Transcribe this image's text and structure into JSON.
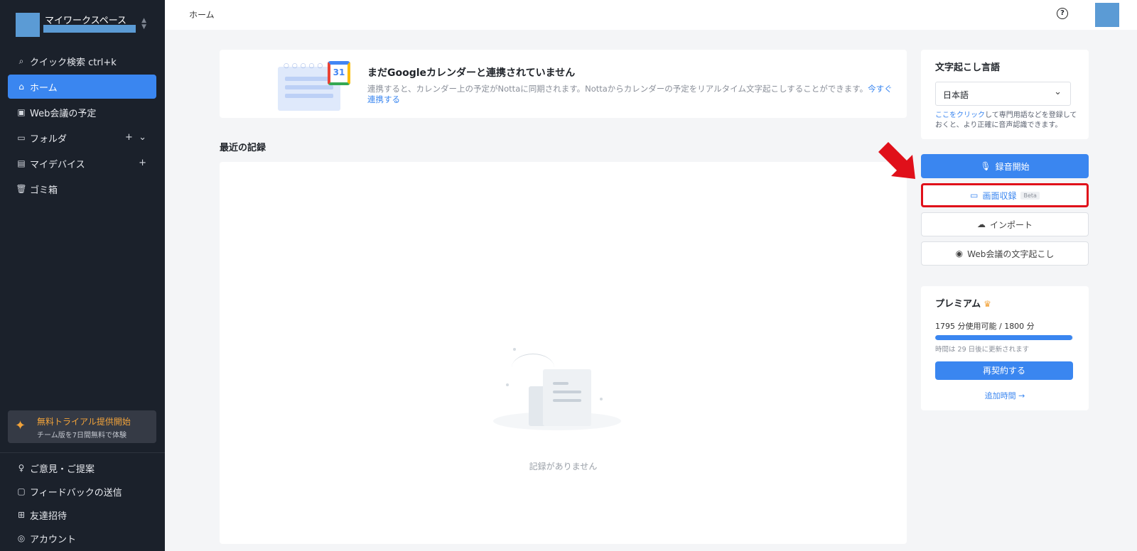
{
  "workspace": {
    "name": "マイワークスペース"
  },
  "sidebar": {
    "items": [
      {
        "label": "クイック検索 ctrl+k",
        "icon": "search-icon"
      },
      {
        "label": "ホーム",
        "icon": "home-icon",
        "active": true
      },
      {
        "label": "Web会議の予定",
        "icon": "calendar-icon"
      },
      {
        "label": "フォルダ",
        "icon": "folder-icon"
      },
      {
        "label": "マイデバイス",
        "icon": "device-icon"
      },
      {
        "label": "ゴミ箱",
        "icon": "trash-icon"
      }
    ],
    "trial": {
      "title": "無料トライアル提供開始",
      "subtitle": "チーム版を7日間無料で体験"
    },
    "bottom_items": [
      {
        "label": "ご意見・ご提案",
        "icon": "lightbulb-icon"
      },
      {
        "label": "フィードバックの送信",
        "icon": "feedback-icon"
      },
      {
        "label": "友達招待",
        "icon": "gift-icon"
      },
      {
        "label": "アカウント",
        "icon": "account-icon"
      }
    ]
  },
  "topbar": {
    "breadcrumb": "ホーム",
    "help_icon": "?"
  },
  "banner": {
    "title": "まだGoogleカレンダーと連携されていません",
    "description": "連携すると、カレンダー上の予定がNottaに同期されます。Nottaからカレンダーの予定をリアルタイム文字起こしすることができます。",
    "link": "今すぐ連携する",
    "calendar_day": "31"
  },
  "records": {
    "title": "最近の記録",
    "empty_text": "記録がありません"
  },
  "language": {
    "title": "文字起こし言語",
    "selected": "日本語",
    "hint_link": "ここをクリック",
    "hint_text": "して専門用語などを登録しておくと、より正確に音声認識できます。"
  },
  "actions": {
    "record": "録音開始",
    "screen": "画面収録",
    "beta": "Beta",
    "import": "インポート",
    "web": "Web会議の文字起こし"
  },
  "premium": {
    "title": "プレミアム",
    "usage": "1795 分使用可能 / 1800 分",
    "usage_fraction": 0.997,
    "renew_note": "時間は 29 日後に更新されます",
    "renew_button": "再契約する",
    "more": "追加時間 →"
  },
  "colors": {
    "accent": "#3a86f0",
    "sidebar": "#1b212b",
    "highlight": "#e0101a",
    "trial": "#f2a33a"
  }
}
